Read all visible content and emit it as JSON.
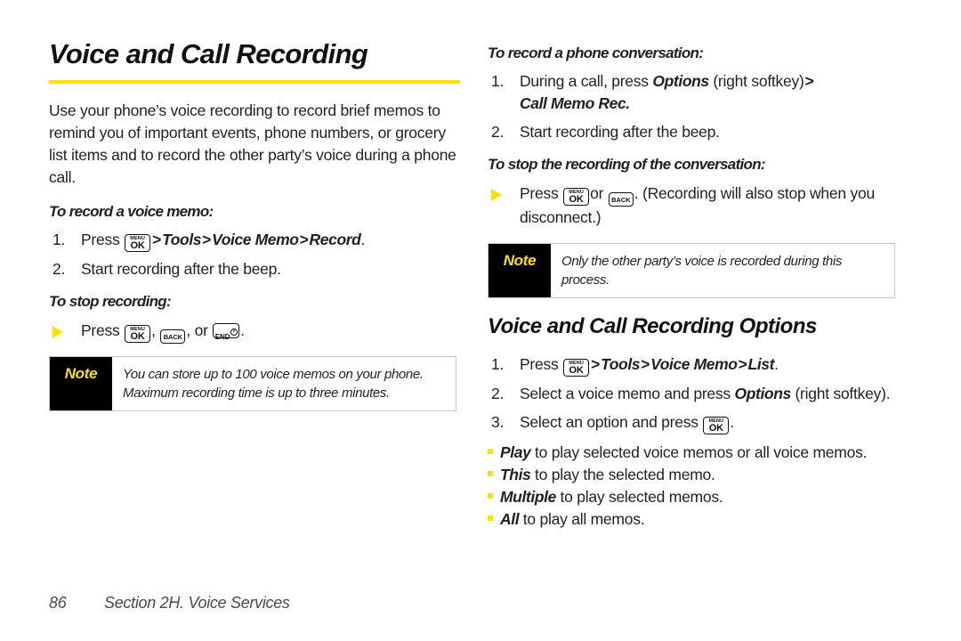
{
  "document": {
    "page_title": "Voice and Call Recording",
    "accent_color": "#ffe100",
    "note_label_bg": "#000000"
  },
  "left_column": {
    "intro": "Use your phone’s voice recording to record brief memos to remind you of important events, phone numbers, or grocery list items and to record the other party’s voice during a phone call.",
    "subhead_record": "To record a voice memo:",
    "steps": [
      {
        "num": "1.",
        "prefix": "Press",
        "key": "menu-ok-key",
        "path_1": "Tools",
        "path_2": "Voice Memo",
        "path_3": "Record",
        "suffix": "."
      },
      {
        "num": "2.",
        "text": "Start recording after the beep."
      }
    ],
    "subhead_stop": "To stop recording:",
    "stop_bullet": {
      "prefix": "Press",
      "sep_1": ",",
      "sep_2": ", or",
      "suffix": "."
    },
    "note": {
      "label": "Note",
      "text": "You can store up to 100 voice memos on your phone. Maximum recording time is up to three minutes."
    }
  },
  "right_column": {
    "subhead_conversation": "To record a phone conversation:",
    "conversation_steps": [
      {
        "num": "1.",
        "text_a": "During a call, press",
        "emphasis": "Options",
        "text_b": "(right softkey)",
        "arrow": ">",
        "emphasis_2": "Call Memo Rec."
      },
      {
        "num": "2.",
        "text": "Start recording after the beep."
      }
    ],
    "subhead_stop_conversation": "To stop the recording of the conversation:",
    "stop_bullet": {
      "prefix": "Press",
      "middle": "or",
      "suffix": ". (Recording will also stop when you disconnect.)"
    },
    "note": {
      "label": "Note",
      "text": "Only the other party’s voice is recorded during this process."
    },
    "section_title": "Voice and Call Recording Options",
    "option_steps": [
      {
        "num": "1.",
        "prefix": "Press",
        "path_1": "Tools",
        "path_2": "Voice Memo",
        "path_3": "List",
        "suffix": "."
      },
      {
        "num": "2.",
        "text_a": "Select a voice memo and press",
        "emphasis": "Options",
        "text_b": "(right softkey)."
      },
      {
        "num": "3.",
        "text_a": "Select an option and press",
        "text_b": "."
      }
    ],
    "option_bullets": [
      {
        "level": 2,
        "term": "Play",
        "text": "to play selected voice memos or all voice memos."
      },
      {
        "level": 3,
        "term": "This",
        "text": "to play the selected memo."
      },
      {
        "level": 3,
        "term": "Multiple",
        "text": "to play selected memos."
      },
      {
        "level": 3,
        "term": "All",
        "text": "to play all memos."
      }
    ]
  },
  "footer": {
    "page_number": "86",
    "section_label": "Section 2H. Voice Services"
  },
  "icons": {
    "menu_ok_top": "MENU",
    "menu_ok_main": "OK",
    "back_main": "BACK",
    "end_main": "END"
  }
}
